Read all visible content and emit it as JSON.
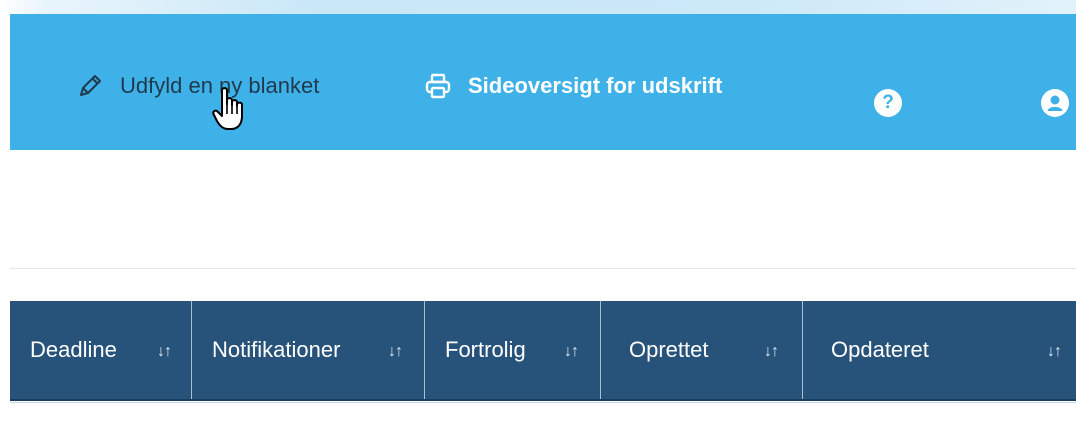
{
  "navbar": {
    "fill_label": "Udfyld en ny blanket",
    "print_label": "Sideoversigt for udskrift",
    "help_glyph": "?",
    "background": "#3eb1e9",
    "icons": [
      "pencil-icon",
      "printer-icon",
      "help-icon",
      "user-icon",
      "hand-cursor-icon"
    ]
  },
  "table": {
    "header_background": "#27527a",
    "sort_glyph": "↓↑",
    "columns": [
      {
        "label": "Deadline"
      },
      {
        "label": "Notifikationer"
      },
      {
        "label": "Fortrolig"
      },
      {
        "label": "Oprettet"
      },
      {
        "label": "Opdateret"
      }
    ]
  }
}
